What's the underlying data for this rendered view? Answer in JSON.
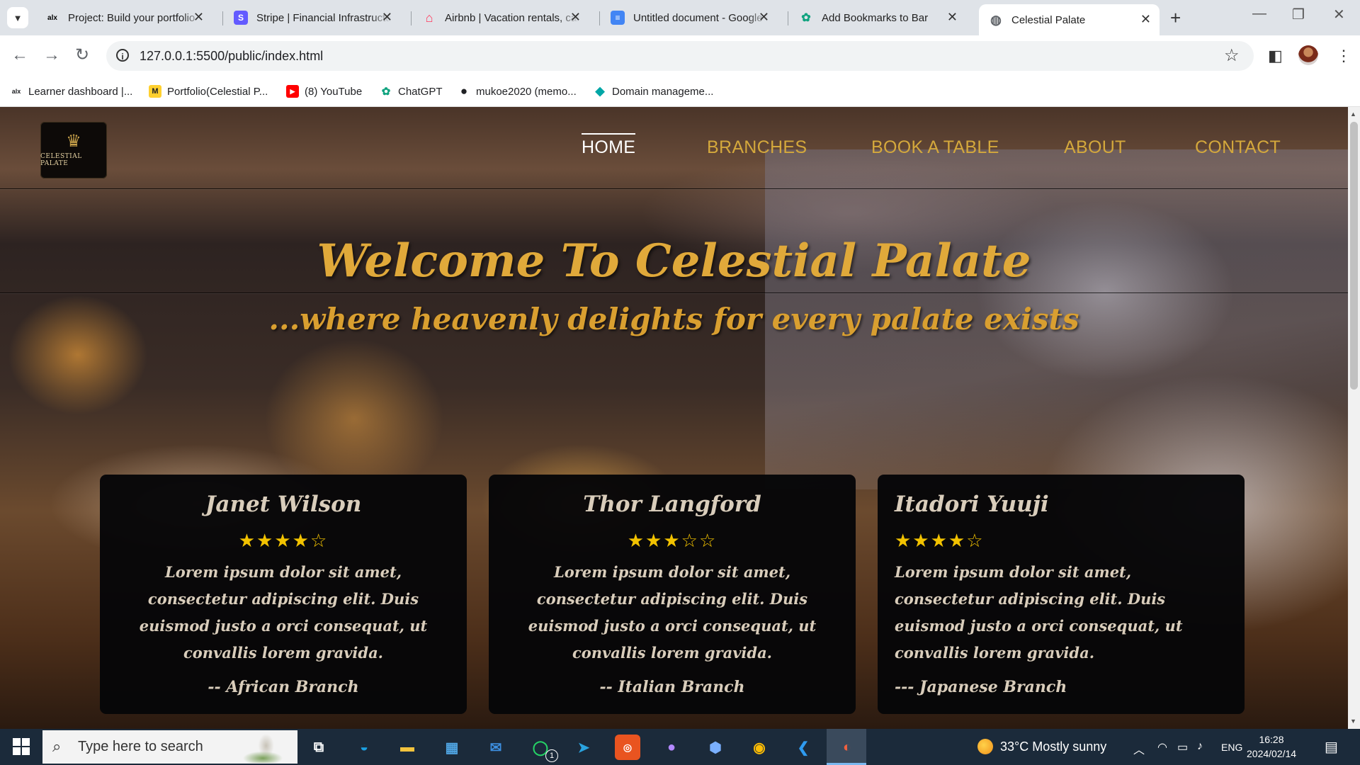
{
  "browser": {
    "tabs": [
      {
        "title": "Project: Build your portfolio",
        "favicon": "alx-icon",
        "icon_text": "alx",
        "icon_color": "#111111",
        "icon_bg": "transparent"
      },
      {
        "title": "Stripe | Financial Infrastructure",
        "favicon": "stripe-icon",
        "icon_text": "S",
        "icon_color": "#ffffff",
        "icon_bg": "#635bff"
      },
      {
        "title": "Airbnb | Vacation rentals, cabins",
        "favicon": "airbnb-icon",
        "icon_text": "⌂",
        "icon_color": "#ff385c",
        "icon_bg": "transparent"
      },
      {
        "title": "Untitled document - Google Docs",
        "favicon": "docs-icon",
        "icon_text": "≡",
        "icon_color": "#ffffff",
        "icon_bg": "#4285f4"
      },
      {
        "title": "Add Bookmarks to Bar",
        "favicon": "chatgpt-icon",
        "icon_text": "✿",
        "icon_color": "#10a37f",
        "icon_bg": "transparent"
      },
      {
        "title": "Celestial Palate",
        "favicon": "globe-icon",
        "icon_text": "◍",
        "icon_color": "#5f6368",
        "icon_bg": "transparent"
      }
    ],
    "tab_close_glyph": "✕",
    "new_tab_glyph": "+",
    "url": "127.0.0.1:5500/public/index.html",
    "bookmarks": [
      {
        "label": "Learner dashboard |...",
        "icon": "alx-icon",
        "icon_text": "alx",
        "icon_color": "#111111",
        "icon_bg": "transparent"
      },
      {
        "label": "Portfolio(Celestial P...",
        "icon": "miro-icon",
        "icon_text": "M",
        "icon_color": "#111111",
        "icon_bg": "#ffd02f"
      },
      {
        "label": "(8) YouTube",
        "icon": "youtube-icon",
        "icon_text": "▶",
        "icon_color": "#ffffff",
        "icon_bg": "#ff0000"
      },
      {
        "label": "ChatGPT",
        "icon": "chatgpt-icon",
        "icon_text": "✿",
        "icon_color": "#10a37f",
        "icon_bg": "transparent"
      },
      {
        "label": "mukoe2020 (memo...",
        "icon": "github-icon",
        "icon_text": "●",
        "icon_color": "#111111",
        "icon_bg": "transparent"
      },
      {
        "label": "Domain manageme...",
        "icon": "domain-icon",
        "icon_text": "◆",
        "icon_color": "#00a6a6",
        "icon_bg": "transparent"
      }
    ]
  },
  "site": {
    "logo_text": "CELESTIAL PALATE",
    "nav": [
      "HOME",
      "BRANCHES",
      "BOOK A TABLE",
      "ABOUT",
      "CONTACT"
    ],
    "hero_title": "Welcome To Celestial Palate",
    "hero_subtitle": "...where heavenly delights for every palate exists",
    "colors": {
      "accent": "#d4a83c",
      "card_bg": "#060608",
      "star": "#f2c200"
    },
    "reviews": [
      {
        "name": "Janet Wilson",
        "stars": "★★★★☆",
        "rating": 4,
        "text": "Lorem ipsum dolor sit amet, consectetur adipiscing elit. Duis euismod justo a orci consequat, ut convallis lorem gravida.",
        "branch": "-- African Branch"
      },
      {
        "name": "Thor Langford",
        "stars": "★★★☆☆",
        "rating": 3,
        "text": "Lorem ipsum dolor sit amet, consectetur adipiscing elit. Duis euismod justo a orci consequat, ut convallis lorem gravida.",
        "branch": "-- Italian Branch"
      },
      {
        "name": "Itadori Yuuji",
        "stars": "★★★★☆",
        "rating": 4,
        "text": "Lorem ipsum dolor sit amet, consectetur adipiscing elit. Duis euismod justo a orci consequat, ut convallis lorem gravida.",
        "branch": "--- Japanese Branch"
      }
    ]
  },
  "taskbar": {
    "search_placeholder": "Type here to search",
    "weather": "33°C  Mostly sunny",
    "language": "ENG",
    "time": "16:28",
    "date": "2024/02/14",
    "whatsapp_badge": "1"
  }
}
